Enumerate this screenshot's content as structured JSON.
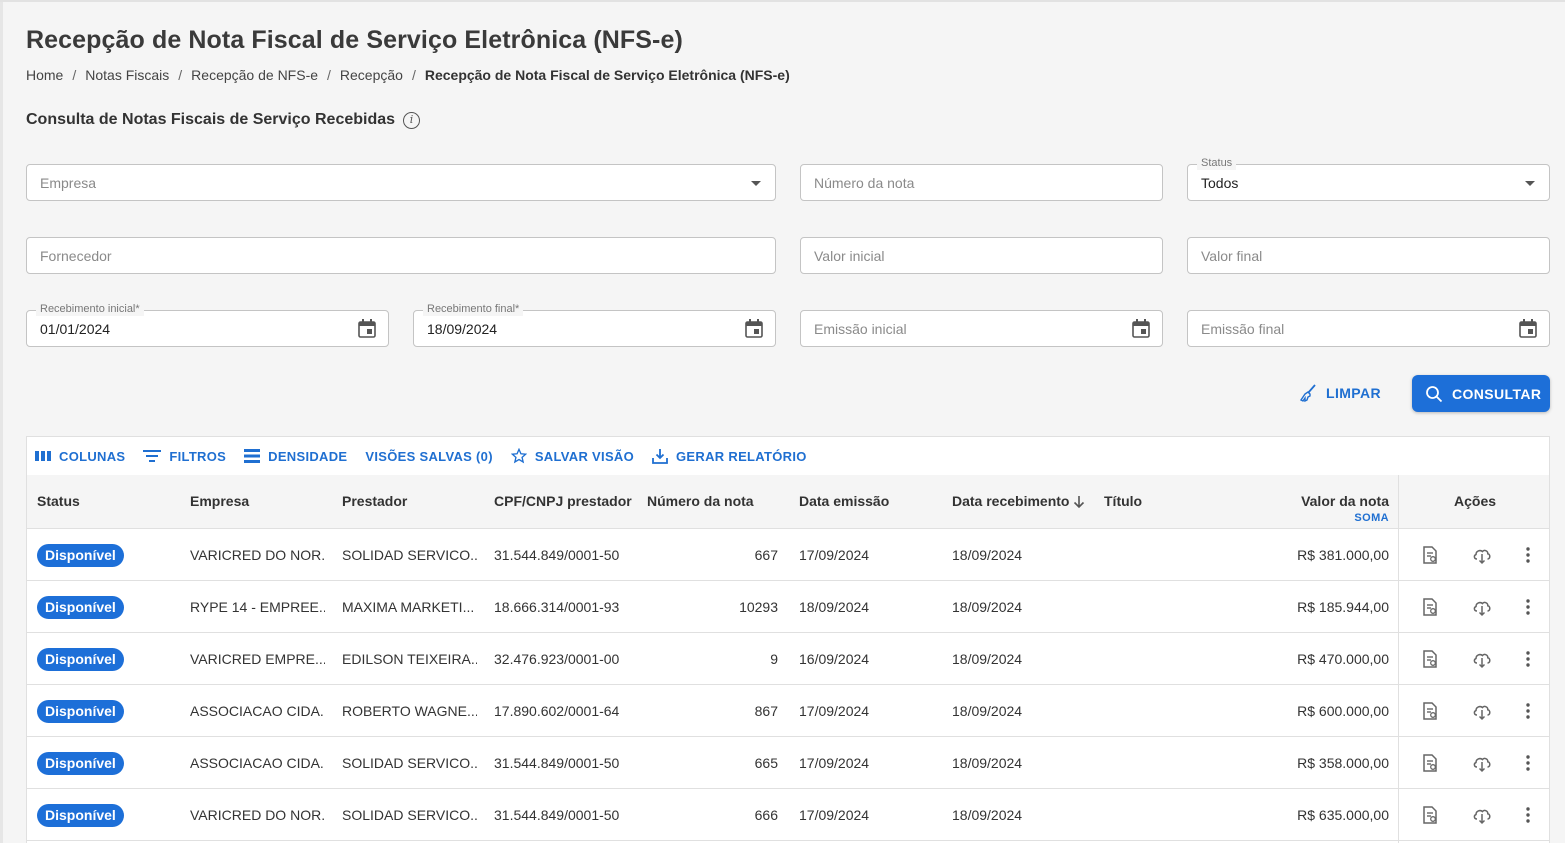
{
  "page": {
    "title": "Recepção de Nota Fiscal de Serviço Eletrônica (NFS-e)",
    "breadcrumb": [
      "Home",
      "Notas Fiscais",
      "Recepção de NFS-e",
      "Recepção",
      "Recepção de Nota Fiscal de Serviço Eletrônica (NFS-e)"
    ],
    "section_title": "Consulta de Notas Fiscais de Serviço Recebidas",
    "info_glyph": "i"
  },
  "filters": {
    "empresa_placeholder": "Empresa",
    "numero_nota_placeholder": "Número da nota",
    "status_label": "Status",
    "status_value": "Todos",
    "fornecedor_placeholder": "Fornecedor",
    "valor_inicial_placeholder": "Valor inicial",
    "valor_final_placeholder": "Valor final",
    "recebimento_inicial_label": "Recebimento inicial*",
    "recebimento_inicial_value": "01/01/2024",
    "recebimento_final_label": "Recebimento final*",
    "recebimento_final_value": "18/09/2024",
    "emissao_inicial_placeholder": "Emissão inicial",
    "emissao_final_placeholder": "Emissão final"
  },
  "actions": {
    "limpar": "LIMPAR",
    "consultar": "CONSULTAR"
  },
  "toolbar": {
    "colunas": "COLUNAS",
    "filtros": "FILTROS",
    "densidade": "DENSIDADE",
    "visoes_salvas": "VISÕES SALVAS (0)",
    "salvar_visao": "SALVAR VISÃO",
    "gerar_relatorio": "GERAR RELATÓRIO"
  },
  "table": {
    "columns": {
      "status": "Status",
      "empresa": "Empresa",
      "prestador": "Prestador",
      "cnpj": "CPF/CNPJ prestador",
      "numero": "Número da nota",
      "emissao": "Data emissão",
      "recebimento": "Data recebimento",
      "titulo": "Título",
      "valor": "Valor da nota",
      "soma": "SOMA",
      "acoes": "Ações"
    },
    "sort_icon": "arrow-down-icon",
    "rows": [
      {
        "status": "Disponível",
        "empresa": "VARICRED DO NOR...",
        "prestador": "SOLIDAD SERVICO...",
        "cnpj": "31.544.849/0001-50",
        "numero": "667",
        "emissao": "17/09/2024",
        "recebimento": "18/09/2024",
        "titulo": "",
        "valor": "R$ 381.000,00"
      },
      {
        "status": "Disponível",
        "empresa": "RYPE 14 - EMPREE...",
        "prestador": "MAXIMA MARKETI...",
        "cnpj": "18.666.314/0001-93",
        "numero": "10293",
        "emissao": "18/09/2024",
        "recebimento": "18/09/2024",
        "titulo": "",
        "valor": "R$ 185.944,00"
      },
      {
        "status": "Disponível",
        "empresa": "VARICRED EMPRE...",
        "prestador": "EDILSON TEIXEIRA...",
        "cnpj": "32.476.923/0001-00",
        "numero": "9",
        "emissao": "16/09/2024",
        "recebimento": "18/09/2024",
        "titulo": "",
        "valor": "R$ 470.000,00"
      },
      {
        "status": "Disponível",
        "empresa": "ASSOCIACAO CIDA...",
        "prestador": "ROBERTO WAGNE...",
        "cnpj": "17.890.602/0001-64",
        "numero": "867",
        "emissao": "17/09/2024",
        "recebimento": "18/09/2024",
        "titulo": "",
        "valor": "R$ 600.000,00"
      },
      {
        "status": "Disponível",
        "empresa": "ASSOCIACAO CIDA...",
        "prestador": "SOLIDAD SERVICO...",
        "cnpj": "31.544.849/0001-50",
        "numero": "665",
        "emissao": "17/09/2024",
        "recebimento": "18/09/2024",
        "titulo": "",
        "valor": "R$ 358.000,00"
      },
      {
        "status": "Disponível",
        "empresa": "VARICRED DO NOR...",
        "prestador": "SOLIDAD SERVICO...",
        "cnpj": "31.544.849/0001-50",
        "numero": "666",
        "emissao": "17/09/2024",
        "recebimento": "18/09/2024",
        "titulo": "",
        "valor": "R$ 635.000,00"
      }
    ]
  },
  "colors": {
    "accent": "#1d6fd8",
    "background": "#f5f5f5"
  }
}
